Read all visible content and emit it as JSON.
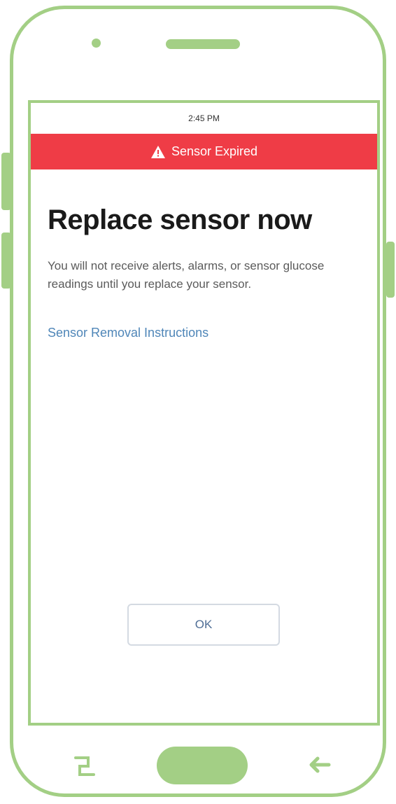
{
  "status_bar": {
    "time": "2:45 PM"
  },
  "banner": {
    "label": "Sensor Expired",
    "icon": "warning-icon",
    "color": "#ef3c46"
  },
  "main": {
    "title": "Replace sensor now",
    "body": "You will not receive alerts, alarms, or sensor glucose readings until you replace your sensor.",
    "link": "Sensor Removal Instructions",
    "ok_label": "OK"
  },
  "device": {
    "frame_color": "#a3cf85"
  },
  "nav": {
    "recent_icon": "recent-apps-icon",
    "home_icon": "home-button",
    "back_icon": "back-arrow-icon"
  }
}
